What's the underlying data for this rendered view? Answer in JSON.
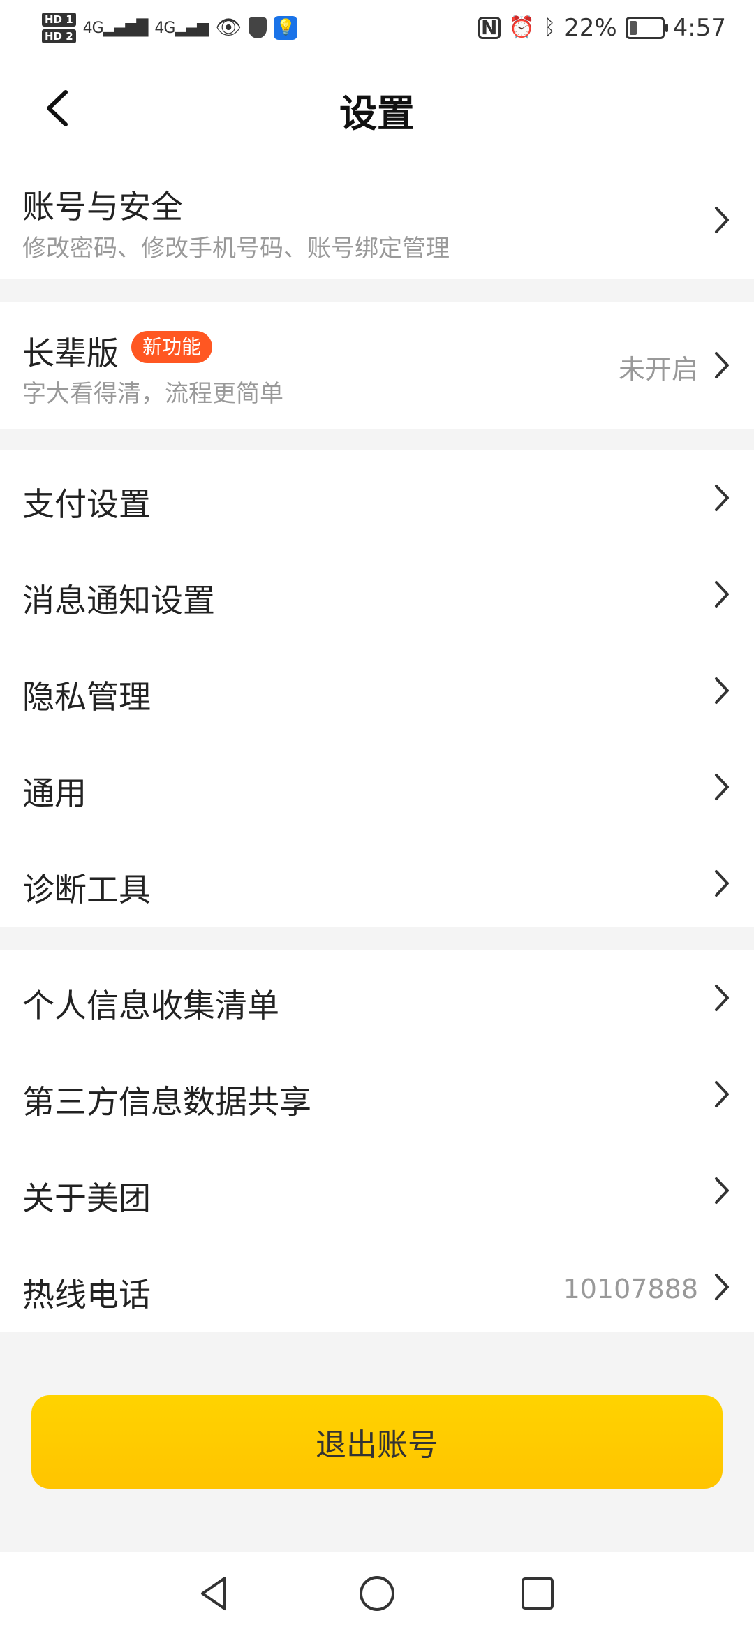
{
  "status_bar": {
    "hd1": "HD 1",
    "hd2": "HD 2",
    "signal1": "4G",
    "signal2": "4G",
    "battery_percent": "22%",
    "battery_level": 0.22,
    "time": "4:57",
    "icons_left": [
      "hd-badge-icon",
      "signal-icon",
      "eye-icon",
      "shield-icon",
      "bulb-icon"
    ],
    "icons_right": [
      "nfc-icon",
      "alarm-icon",
      "bluetooth-icon",
      "battery-icon"
    ]
  },
  "header": {
    "title": "设置",
    "back_icon": "chevron-left-icon"
  },
  "sections": {
    "account": {
      "title": "账号与安全",
      "subtitle": "修改密码、修改手机号码、账号绑定管理"
    },
    "elder": {
      "title": "长辈版",
      "badge": "新功能",
      "subtitle": "字大看得清，流程更简单",
      "value": "未开启"
    },
    "group1": [
      {
        "label": "支付设置"
      },
      {
        "label": "消息通知设置"
      },
      {
        "label": "隐私管理"
      },
      {
        "label": "通用"
      },
      {
        "label": "诊断工具"
      }
    ],
    "group2": [
      {
        "label": "个人信息收集清单"
      },
      {
        "label": "第三方信息数据共享"
      },
      {
        "label": "关于美团"
      },
      {
        "label": "热线电话",
        "value": "10107888"
      }
    ]
  },
  "logout": {
    "label": "退出账号"
  },
  "colors": {
    "accent_yellow": "#ffc400",
    "badge_orange": "#ff5722",
    "divider_gray": "#f4f4f4"
  },
  "navbar": {
    "icons": [
      "back-triangle-icon",
      "home-circle-icon",
      "recents-square-icon"
    ]
  }
}
